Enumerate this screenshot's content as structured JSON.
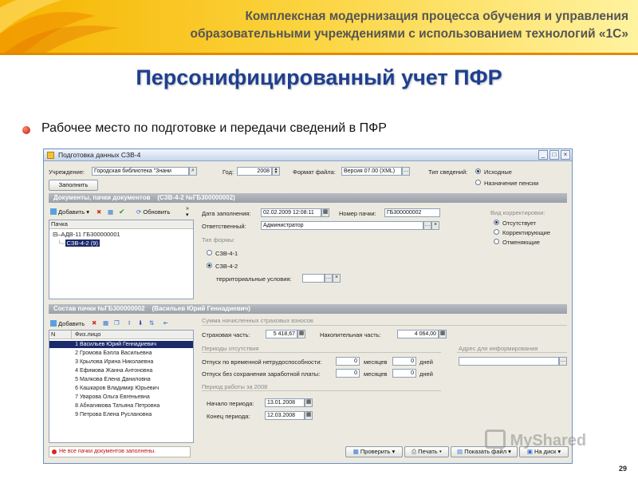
{
  "slide": {
    "header_line1": "Комплексная модернизация процесса обучения и управления",
    "header_line2": "образовательными учреждениями с использованием технологий «1С»",
    "title": "Персонифицированный учет ПФР",
    "subtitle": "Рабочее место по подготовке и передачи сведений в ПФР",
    "page_number": "29",
    "watermark": "MyShared"
  },
  "window": {
    "title": "Подготовка данных СЗВ-4",
    "controls": [
      "_",
      "□",
      "×"
    ]
  },
  "top": {
    "institution_label": "Учреждение:",
    "institution_value": "Городская библиотека \"Знани",
    "year_label": "Год:",
    "year_value": "2008",
    "format_label": "Формат файла:",
    "format_value": "Версия 07.00 (XML)",
    "info_type_label": "Тип сведений:",
    "info_type_options": [
      "Исходные",
      "Назначение пенсии"
    ],
    "info_type_selected": 0,
    "fill_button": "Заполнить"
  },
  "docs_section": {
    "header": "Документы, пачки документов",
    "header_detail": "(СЗВ-4-2 №ГБ300000002)",
    "toolbar": {
      "add": "Добавить",
      "refresh": "Обновить"
    },
    "tree_header": "Пачка",
    "tree": [
      {
        "text": "АДВ-11 ГБ300000001",
        "level": 0
      },
      {
        "text": "СЗВ-4-2 (9)",
        "level": 1,
        "selected": true
      }
    ]
  },
  "doc_form": {
    "fill_date_label": "Дата заполнения:",
    "fill_date_value": "02.02.2009 12:08:11",
    "pack_number_label": "Номер пачки:",
    "pack_number_value": "ГБ300000002",
    "responsible_label": "Ответственный:",
    "responsible_value": "Администратор",
    "form_type_label": "Тип формы:",
    "form_types": [
      "СЗВ-4-1",
      "СЗВ-4-2"
    ],
    "form_type_selected": 1,
    "territorial_label": "территориальные условия:",
    "territorial_value": "",
    "correction_label": "Вид корректировки:",
    "correction_options": [
      "Отсутствует",
      "Корректирующие",
      "Отменяющие"
    ],
    "correction_selected": 0
  },
  "pack_section": {
    "header": "Состав пачки №ГБ300000002",
    "header_detail": "(Васильев Юрий Геннадиевич)",
    "toolbar": {
      "add": "Добавить"
    },
    "columns": [
      "N",
      "Физ.лицо"
    ],
    "rows": [
      {
        "n": "1",
        "name": "Васильев Юрий Геннадиевич",
        "selected": true
      },
      {
        "n": "2",
        "name": "Громова Бэлла Васильевна"
      },
      {
        "n": "3",
        "name": "Крылова Ирина Николаевна"
      },
      {
        "n": "4",
        "name": "Ефимова Жанна Антоновна"
      },
      {
        "n": "5",
        "name": "Малкова Елена Даниловна"
      },
      {
        "n": "6",
        "name": "Кашкаров Владимир Юрьевич"
      },
      {
        "n": "7",
        "name": "Уварова Ольга Евгеньевна"
      },
      {
        "n": "8",
        "name": "Абнагимова Татьяна Петровна"
      },
      {
        "n": "9",
        "name": "Петрова Елена Руслановна"
      }
    ]
  },
  "contrib": {
    "title": "Сумма начисленных страховых взносов",
    "insurance_label": "Страховая часть:",
    "insurance_value": "5 418,67",
    "funded_label": "Накопительная часть:",
    "funded_value": "4 064,00",
    "absence_title": "Периоды отсутствия",
    "sick_label": "Отпуск по временной нетрудоспособности:",
    "sick_months": "0",
    "sick_days": "0",
    "unpaid_label": "Отпуск без сохранения заработной платы:",
    "unpaid_months": "0",
    "unpaid_days": "0",
    "months_label": "месяцев",
    "days_label": "дней",
    "address_title": "Адрес для информирования",
    "work_title": "Период работы за 2008",
    "start_label": "Начало периода:",
    "start_value": "13.01.2008",
    "end_label": "Конец периода:",
    "end_value": "12.03.2008"
  },
  "footer": {
    "status": "Не все пачки документов заполнены.",
    "buttons": [
      "Проверить",
      "Печать",
      "Показать файл",
      "На диск"
    ]
  }
}
